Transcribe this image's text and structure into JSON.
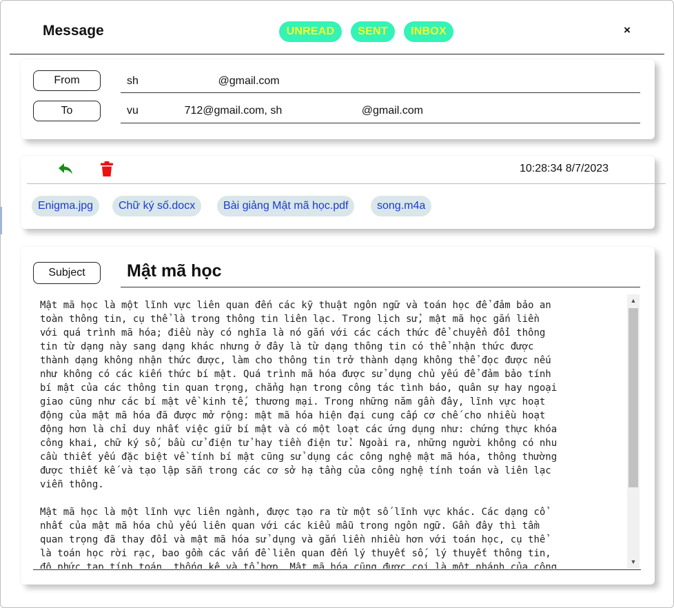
{
  "header": {
    "title": "Message",
    "folders": [
      {
        "label": "UNREAD"
      },
      {
        "label": "SENT"
      },
      {
        "label": "INBOX"
      }
    ],
    "close_label": "×",
    "folder_color": "#33f3b7",
    "folder_text_color": "#ffff22"
  },
  "addresses": {
    "from_label": "From",
    "from_value": "sh                          @gmail.com",
    "to_label": "To",
    "to_value": "vu               712@gmail.com, sh                          @gmail.com"
  },
  "toolbar": {
    "reply_icon": "reply-icon",
    "delete_icon": "trash-icon",
    "timestamp": "10:28:34 8/7/2023"
  },
  "attachments": [
    {
      "name": "Enigma.jpg"
    },
    {
      "name": "Chữ ký số.docx"
    },
    {
      "name": "Bài giảng Mật mã học.pdf"
    },
    {
      "name": "song.m4a"
    }
  ],
  "subject": {
    "label": "Subject",
    "value": "Mật mã học"
  },
  "body": {
    "text": "Mật mã học là một lĩnh vực liên quan đến các kỹ thuật ngôn ngữ và toán học để đảm bảo an\ntoàn thông tin, cụ thể là trong thông tin liên lạc. Trong lịch sử, mật mã học gắn liền\nvới quá trình mã hóa; điều này có nghĩa là nó gắn với các cách thức để chuyển đổi thông\ntin từ dạng này sang dạng khác nhưng ở đây là từ dạng thông tin có thể nhận thức được\nthành dạng không nhận thức được, làm cho thông tin trở thành dạng không thể đọc được nếu\nnhư không có các kiến thức bí mật. Quá trình mã hóa được sử dụng chủ yếu để đảm bảo tính\nbí mật của các thông tin quan trọng, chẳng hạn trong công tác tình báo, quân sự hay ngoại\ngiao cũng như các bí mật về kinh tế, thương mại. Trong những năm gần đây, lĩnh vực hoạt\nđộng của mật mã hóa đã được mở rộng: mật mã hóa hiện đại cung cấp cơ chế cho nhiều hoạt\nđộng hơn là chỉ duy nhất việc giữ bí mật và có một loạt các ứng dụng như: chứng thực khóa\ncông khai, chữ ký số, bầu cử điện tử hay tiền điện tử. Ngoài ra, những người không có nhu\ncầu thiết yếu đặc biệt về tính bí mật cũng sử dụng các công nghệ mật mã hóa, thông thường\nđược thiết kế và tạo lập sẵn trong các cơ sở hạ tầng của công nghệ tính toán và liên lạc\nviễn thông.\n\nMật mã học là một lĩnh vực liên ngành, được tạo ra từ một số lĩnh vực khác. Các dạng cổ\nnhất của mật mã hóa chủ yếu liên quan với các kiểu mẫu trong ngôn ngữ. Gần đây thì tầm\nquan trọng đã thay đổi và mật mã hóa sử dụng và gắn liền nhiều hơn với toán học, cụ thể\nlà toán học rời rạc, bao gồm các vấn đề liên quan đến lý thuyết số, lý thuyết thông tin,\nđộ phức tạp tính toán, thống kê và tổ hợp. Mật mã hóa cũng được coi là một nhánh của công"
  }
}
